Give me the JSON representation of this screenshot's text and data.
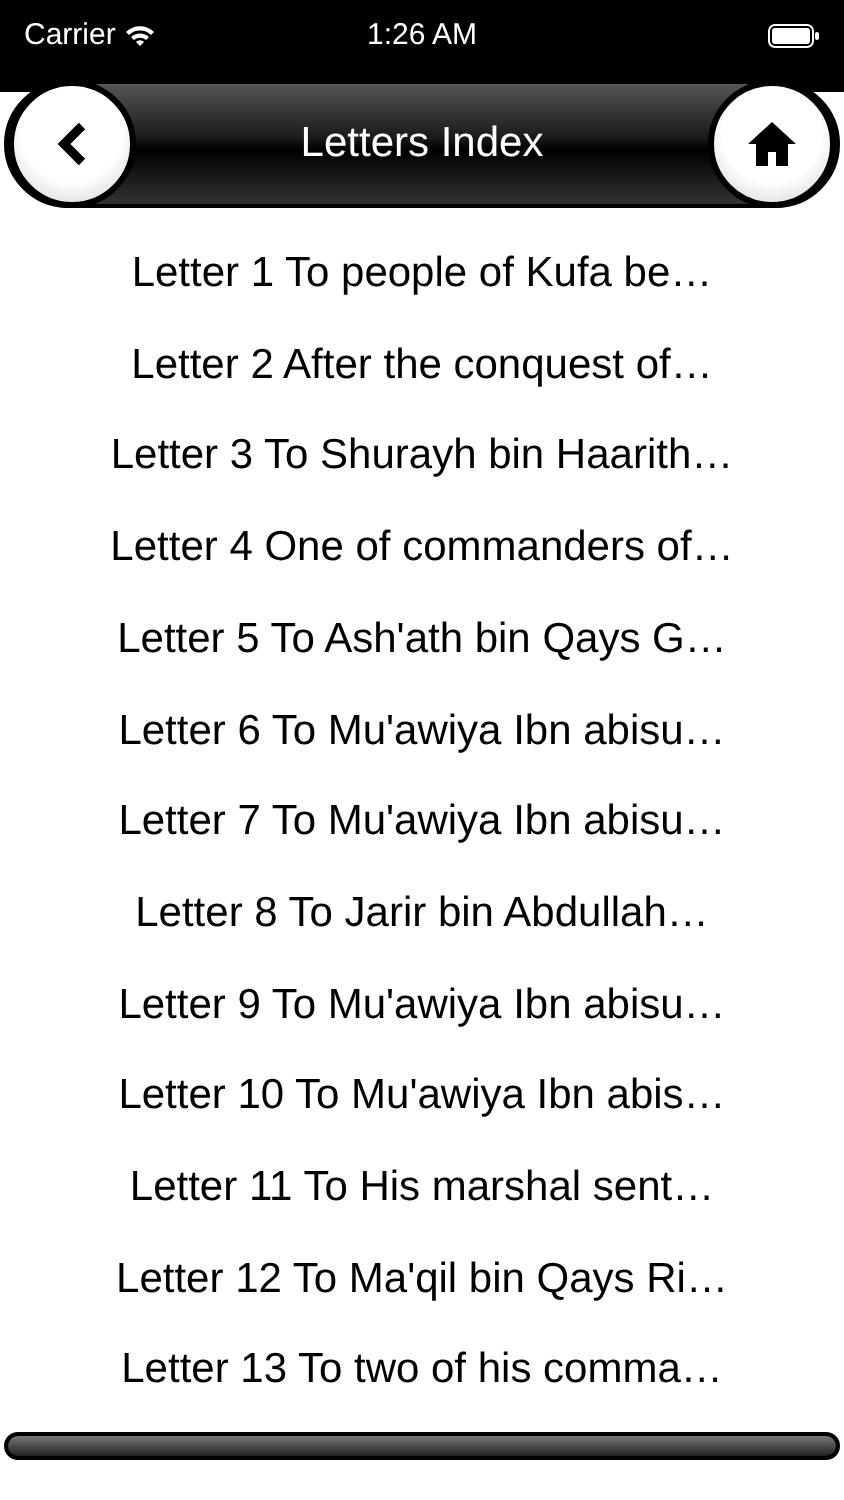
{
  "status_bar": {
    "carrier": "Carrier",
    "time": "1:26 AM"
  },
  "header": {
    "title": "Letters Index"
  },
  "letters": [
    "Letter 1 To people of Kufa be…",
    "Letter 2 After the conquest of…",
    "Letter 3 To Shurayh bin Haarith…",
    "Letter 4 One of commanders of…",
    "Letter 5 To Ash'ath bin Qays G…",
    "Letter 6 To Mu'awiya Ibn abisu…",
    "Letter 7 To Mu'awiya Ibn abisu…",
    "Letter 8 To Jarir bin Abdullah…",
    "Letter 9 To Mu'awiya Ibn abisu…",
    "Letter 10 To Mu'awiya Ibn abis…",
    "Letter 11 To His marshal sent…",
    "Letter 12 To Ma'qil bin Qays Ri…",
    "Letter 13 To two of his comma…"
  ]
}
